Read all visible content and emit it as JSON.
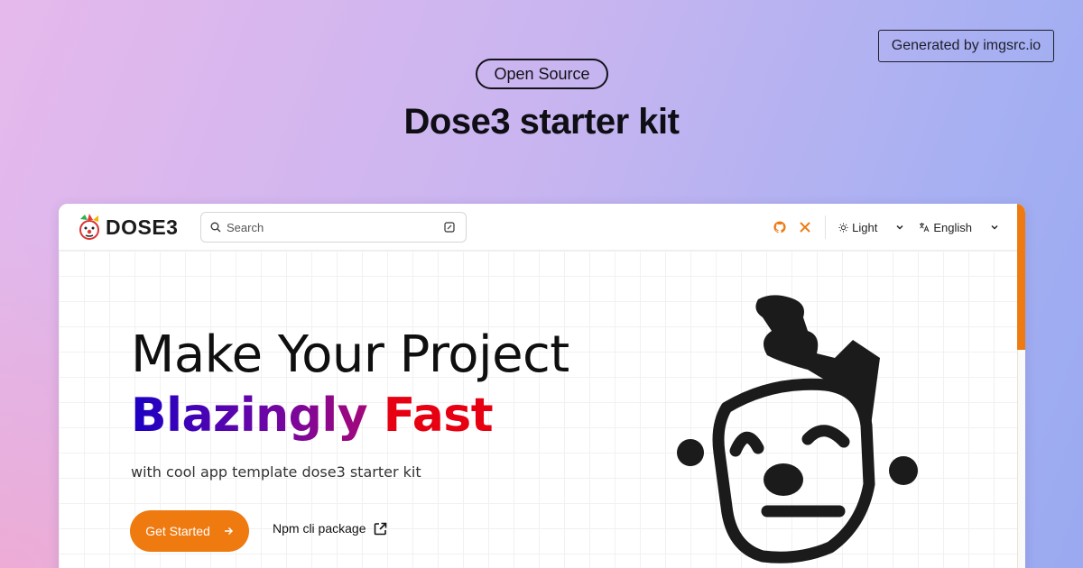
{
  "header": {
    "generated_badge": "Generated by imgsrc.io",
    "pill": "Open Source",
    "title": "Dose3 starter kit"
  },
  "app": {
    "brand": "DOSE3",
    "search_placeholder": "Search",
    "theme_label": "Light",
    "language_label": "English",
    "accent_color": "#ee7a10",
    "icons": [
      "github-icon",
      "x-icon",
      "sun-icon",
      "translate-icon",
      "search-icon",
      "keyboard-shortcut-icon",
      "chevron-down-icon",
      "arrow-right-icon",
      "external-link-icon"
    ]
  },
  "hero": {
    "line1": "Make Your Project",
    "line2_a": "Blazingly",
    "line2_b": "Fast",
    "subtitle": "with cool app template dose3 starter kit",
    "primary_button": "Get Started",
    "secondary_link": "Npm cli package"
  }
}
